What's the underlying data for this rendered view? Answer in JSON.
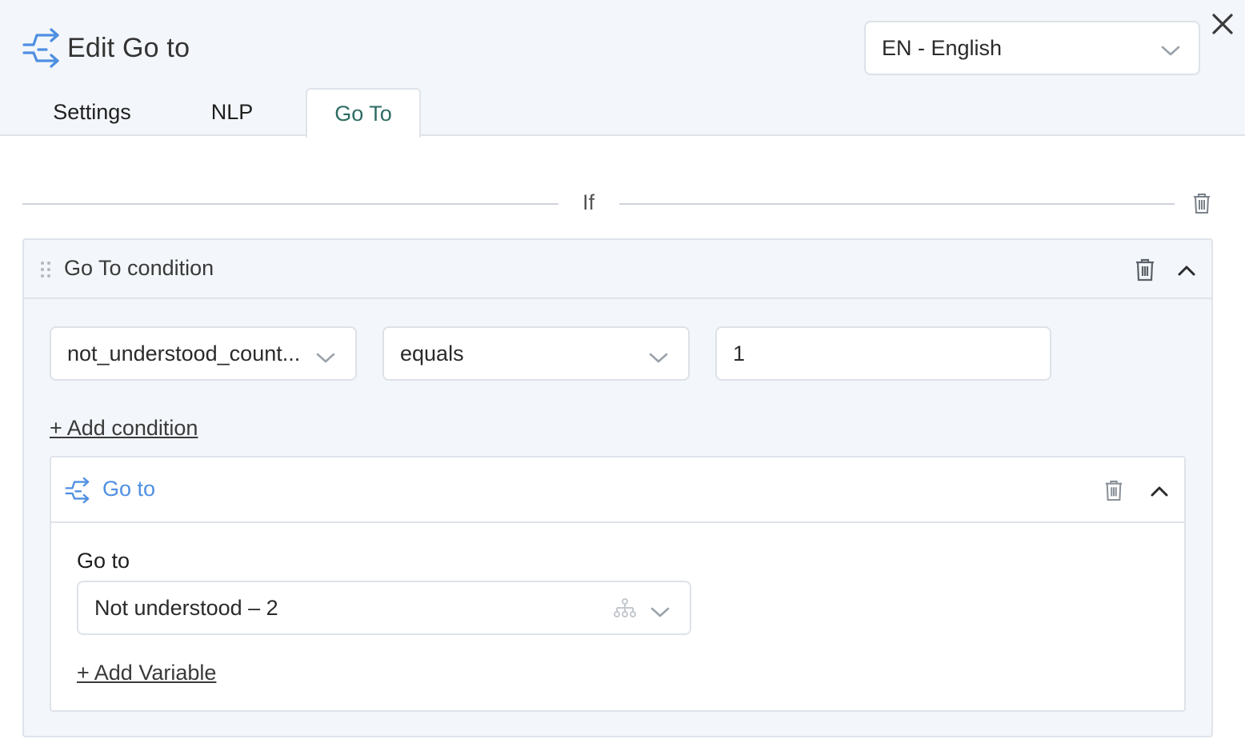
{
  "header": {
    "title": "Edit Go to",
    "title_icon": "goto-arrows-icon",
    "language_select": {
      "value": "EN - English"
    },
    "close_icon": "close-icon"
  },
  "tabs": [
    {
      "label": "Settings",
      "active": false
    },
    {
      "label": "NLP",
      "active": false
    },
    {
      "label": "Go To",
      "active": true
    }
  ],
  "if_section": {
    "label": "If"
  },
  "condition": {
    "title": "Go To condition",
    "variable": "not_understood_count...",
    "operator": "equals",
    "value": "1",
    "add_condition_label": "+ Add condition"
  },
  "goto_block": {
    "title": "Go to",
    "field_label": "Go to",
    "target": "Not understood – 2",
    "add_variable_label": "+ Add Variable"
  },
  "colors": {
    "accent_blue": "#4f8fe2",
    "active_tab_text": "#2e6b63",
    "panel_bg": "#f3f6fa",
    "border": "#dfe4ea"
  }
}
